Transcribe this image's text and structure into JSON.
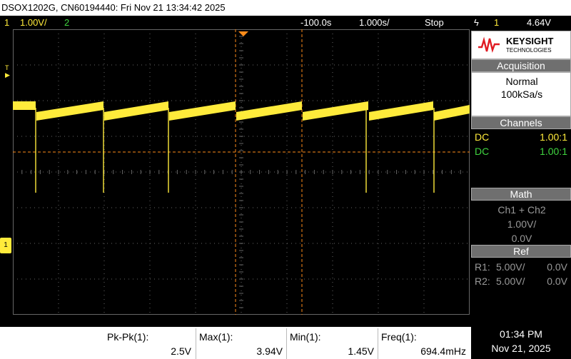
{
  "title_bar": "DSOX1202G, CN60194440: Fri Nov 21 13:34:42 2025",
  "top_bar": {
    "ch1_num": "1",
    "ch1_scale": "1.00V/",
    "ch2_num": "2",
    "delay": "-100.0s",
    "timebase": "1.000s/",
    "run_state": "Stop",
    "trigger_symbol": "ϟ",
    "trigger_ch": "1",
    "trigger_level": "4.64V"
  },
  "left_markers": {
    "trigger_marker": "T",
    "ground_marker": "1"
  },
  "panel": {
    "brand": "KEYSIGHT",
    "brand_sub": "TECHNOLOGIES",
    "acquisition_title": "Acquisition",
    "acq_mode": "Normal",
    "acq_rate": "100kSa/s",
    "channels_title": "Channels",
    "ch1_coupling": "DC",
    "ch1_probe": "1.00:1",
    "ch2_coupling": "DC",
    "ch2_probe": "1.00:1",
    "math_title": "Math",
    "math_func": "Ch1 + Ch2",
    "math_scale": "1.00V/",
    "math_offset": "0.0V",
    "ref_title": "Ref",
    "r1_label": "R1:",
    "r1_scale": "5.00V/",
    "r1_offset": "0.0V",
    "r2_label": "R2:",
    "r2_scale": "5.00V/",
    "r2_offset": "0.0V"
  },
  "measurements": [
    {
      "label": "Pk-Pk(1):",
      "value": "2.5V"
    },
    {
      "label": "Max(1):",
      "value": "3.94V"
    },
    {
      "label": "Min(1):",
      "value": "1.45V"
    },
    {
      "label": "Freq(1):",
      "value": "694.4mHz"
    }
  ],
  "clock": {
    "time": "01:34 PM",
    "date": "Nov 21, 2025"
  },
  "colors": {
    "ch1": "#ffeb3b",
    "ch2": "#3fd43f",
    "grid": "#666666",
    "cursor": "#ff8c1a"
  }
}
